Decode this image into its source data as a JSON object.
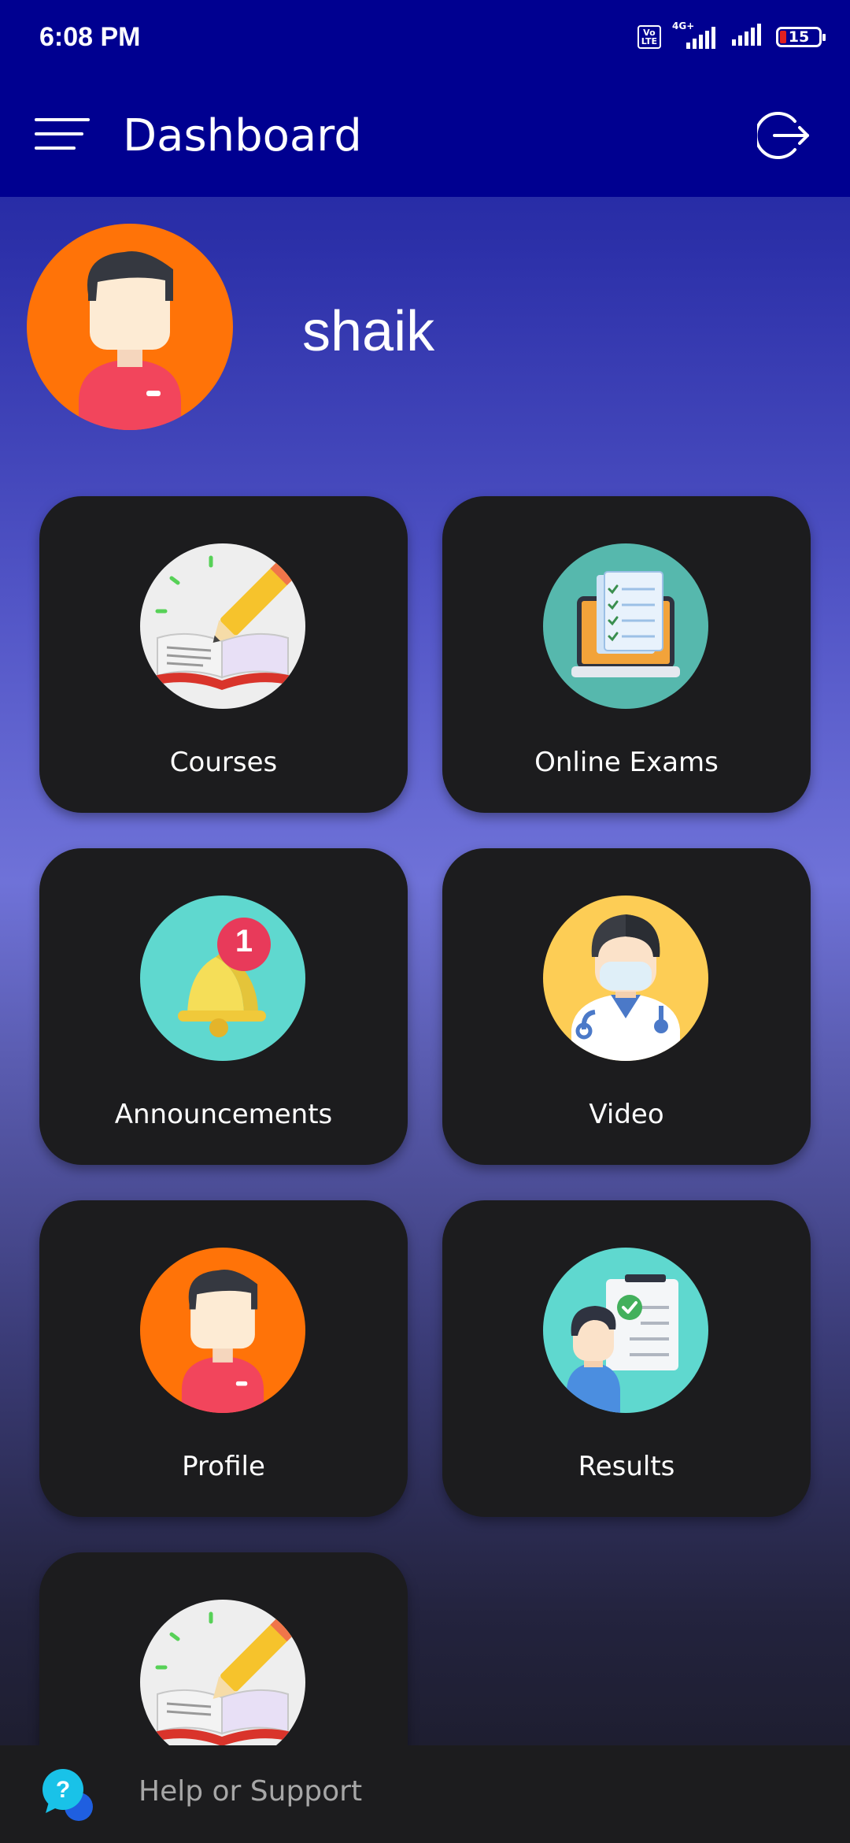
{
  "status_bar": {
    "time": "6:08 PM",
    "volte_top": "Vo",
    "volte_bottom": "LTE",
    "network": "4G+",
    "battery": "15"
  },
  "app_bar": {
    "title": "Dashboard",
    "menu_icon": "hamburger-menu-icon",
    "logout_icon": "logout-icon"
  },
  "user": {
    "name": "shaik",
    "avatar_icon": "user-avatar-icon",
    "avatar_color": "#ff7308"
  },
  "tiles": [
    {
      "label": "Courses",
      "icon": "book-pencil-icon"
    },
    {
      "label": "Online Exams",
      "icon": "laptop-checklist-icon"
    },
    {
      "label": "Announcements",
      "icon": "bell-notification-icon",
      "badge": "1"
    },
    {
      "label": "Video",
      "icon": "doctor-icon"
    },
    {
      "label": "Profile",
      "icon": "user-avatar-icon"
    },
    {
      "label": "Results",
      "icon": "clipboard-result-icon"
    },
    {
      "label": "",
      "icon": "book-pencil-icon"
    }
  ],
  "help": {
    "label": "Help or Support",
    "icon": "help-chat-icon"
  },
  "colors": {
    "app_bar": "#000090",
    "tile_bg": "#1c1c1e",
    "accent_orange": "#ff7308",
    "accent_teal": "#5fd8cf"
  }
}
